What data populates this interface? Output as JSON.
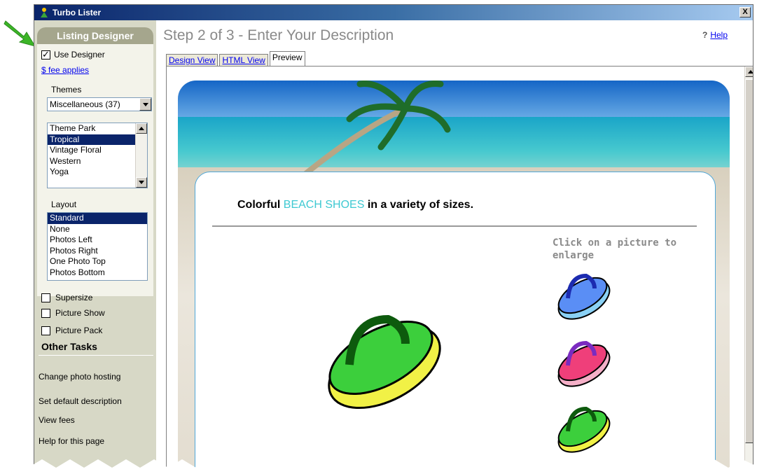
{
  "window": {
    "title": "Turbo Lister",
    "close_label": "X"
  },
  "left_pane": {
    "designer_header": "Listing Designer",
    "use_designer": {
      "label": "Use Designer",
      "checked": true
    },
    "fee_link": "$ fee applies",
    "themes_label": "Themes",
    "themes_select": "Miscellaneous (37)",
    "theme_list": [
      "Theme Park",
      "Tropical",
      "Vintage Floral",
      "Western",
      "Yoga"
    ],
    "theme_selected": "Tropical",
    "layout_label": "Layout",
    "layout_list": [
      "Standard",
      "None",
      "Photos Left",
      "Photos Right",
      "One Photo Top",
      "Photos Bottom"
    ],
    "layout_selected": "Standard",
    "supersize_label": "Supersize",
    "picture_show_label": "Picture Show",
    "picture_pack_label": "Picture Pack",
    "other_tasks_title": "Other Tasks",
    "tasks": [
      "Change photo hosting",
      "Set default description",
      "View fees",
      "Help for this page"
    ]
  },
  "main": {
    "step_title": "Step 2 of 3 - Enter Your Description",
    "help_label": "Help",
    "tabs": [
      "Design View",
      "HTML View",
      "Preview"
    ],
    "active_tab": "Preview"
  },
  "preview": {
    "headline_prefix": "Colorful",
    "headline_highlight": "BEACH SHOES",
    "headline_suffix": "in a variety of sizes.",
    "click_hint": "Click on a picture to enlarge"
  },
  "colors": {
    "title_bar": "#0a246a",
    "header_box": "#a5a68d",
    "left_pane_bg": "#d7d8c6",
    "highlight_text": "#3ec9d2",
    "selection": "#0a246a",
    "arrow_annotation": "#3cb527"
  },
  "icons": [
    "app-icon",
    "help-icon",
    "green-arrow-annotation",
    "flip-flop-large",
    "flip-flop-blue",
    "flip-flop-pink",
    "flip-flop-green"
  ]
}
